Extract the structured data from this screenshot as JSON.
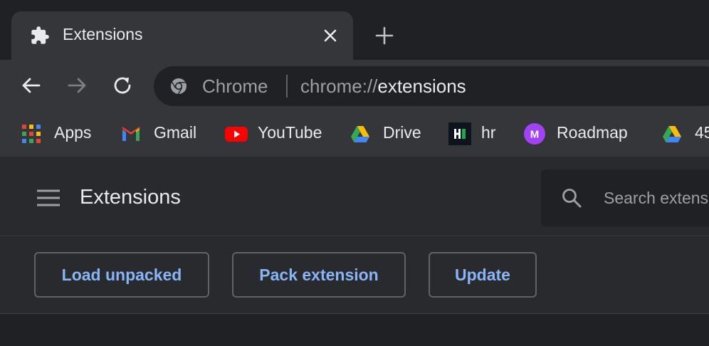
{
  "tab": {
    "title": "Extensions",
    "icon": "puzzle-icon",
    "close_icon": "close-icon"
  },
  "new_tab_icon": "plus-icon",
  "toolbar": {
    "back_icon": "arrow-left-icon",
    "forward_icon": "arrow-right-icon",
    "reload_icon": "reload-icon"
  },
  "omnibox": {
    "chip_label": "Chrome",
    "url_scheme": "chrome://",
    "url_host": "extensions"
  },
  "bookmarks": [
    {
      "label": "Apps",
      "icon": "apps-grid-icon"
    },
    {
      "label": "Gmail",
      "icon": "gmail-icon"
    },
    {
      "label": "YouTube",
      "icon": "youtube-icon"
    },
    {
      "label": "Drive",
      "icon": "drive-icon"
    },
    {
      "label": "hr",
      "icon": "hackerrank-icon"
    },
    {
      "label": "Roadmap",
      "icon": "avatar-m-icon",
      "avatar_letter": "M"
    },
    {
      "label": "45",
      "icon": "drive-icon"
    }
  ],
  "header": {
    "title": "Extensions",
    "menu_icon": "hamburger-menu-icon",
    "search_placeholder": "Search extensions"
  },
  "actions": {
    "load_unpacked": "Load unpacked",
    "pack_extension": "Pack extension",
    "update": "Update"
  },
  "colors": {
    "background": "#202124",
    "toolbar": "#35363a",
    "accent_link": "#8ab4f8",
    "text": "#e8eaed",
    "muted_text": "#9aa0a6"
  }
}
